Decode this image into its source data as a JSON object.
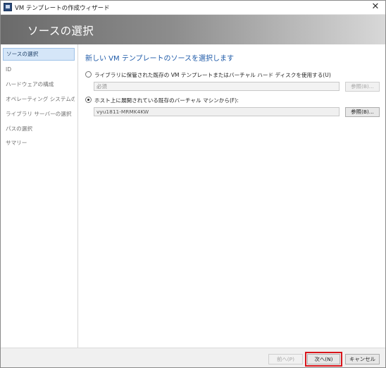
{
  "window": {
    "title": "VM テンプレートの作成ウィザード",
    "close_symbol": "✕"
  },
  "header": {
    "title": "ソースの選択"
  },
  "sidebar": {
    "items": [
      {
        "label": "ソースの選択",
        "active": true
      },
      {
        "label": "ID",
        "active": false
      },
      {
        "label": "ハードウェアの構成",
        "active": false
      },
      {
        "label": "オペレーティング システムの構成",
        "active": false
      },
      {
        "label": "ライブラリ サーバーの選択",
        "active": false
      },
      {
        "label": "パスの選択",
        "active": false
      },
      {
        "label": "サマリー",
        "active": false
      }
    ]
  },
  "main": {
    "heading": "新しい VM テンプレートのソースを選択します",
    "option_library": {
      "label": "ライブラリに保管された既存の VM テンプレートまたはバーチャル ハード ディスクを使用する(U)",
      "checked": false,
      "input_value": "必須",
      "browse_label": "参照(B)..."
    },
    "option_host": {
      "label": "ホスト上に展開されている既存のバーチャル マシンから(F):",
      "checked": true,
      "input_value": "vyu1811-MRMK4KW",
      "browse_label": "参照(B)..."
    }
  },
  "footer": {
    "prev_label": "前へ(P)",
    "next_label": "次へ(N)",
    "cancel_label": "キャンセル",
    "highlight_color": "#d8151b"
  },
  "colors": {
    "accent": "#1e5aa8",
    "nav_active_bg": "#d5e6f8"
  }
}
